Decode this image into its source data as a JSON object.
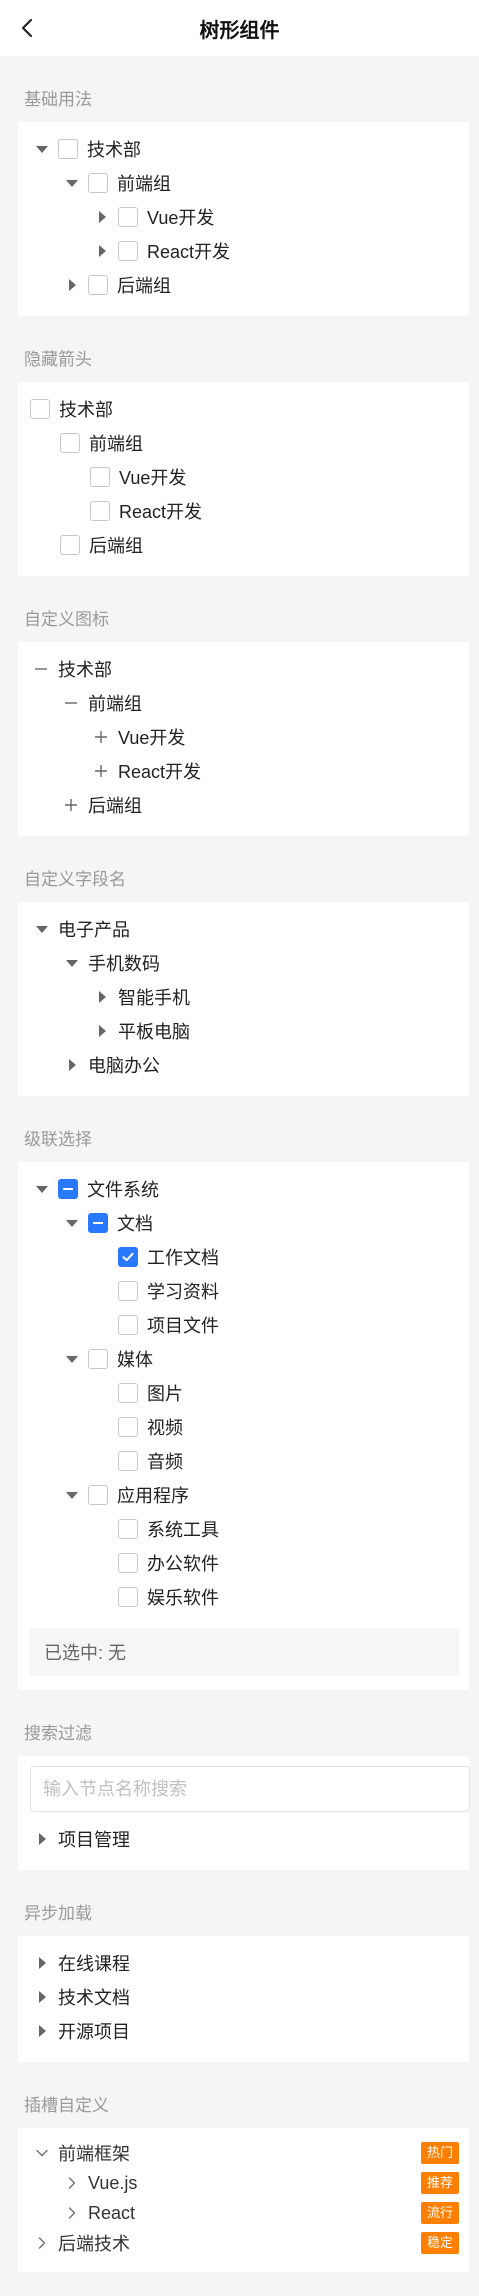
{
  "header": {
    "title": "树形组件"
  },
  "basic": {
    "title": "基础用法",
    "n1": "技术部",
    "n2": "前端组",
    "n3": "Vue开发",
    "n4": "React开发",
    "n5": "后端组"
  },
  "hidden_arrow": {
    "title": "隐藏箭头",
    "n1": "技术部",
    "n2": "前端组",
    "n3": "Vue开发",
    "n4": "React开发",
    "n5": "后端组"
  },
  "custom_icon": {
    "title": "自定义图标",
    "n1": "技术部",
    "n2": "前端组",
    "n3": "Vue开发",
    "n4": "React开发",
    "n5": "后端组"
  },
  "custom_field": {
    "title": "自定义字段名",
    "n1": "电子产品",
    "n2": "手机数码",
    "n3": "智能手机",
    "n4": "平板电脑",
    "n5": "电脑办公"
  },
  "cascade": {
    "title": "级联选择",
    "root": "文件系统",
    "docs": "文档",
    "doc1": "工作文档",
    "doc2": "学习资料",
    "doc3": "项目文件",
    "media": "媒体",
    "media1": "图片",
    "media2": "视频",
    "media3": "音频",
    "apps": "应用程序",
    "app1": "系统工具",
    "app2": "办公软件",
    "app3": "娱乐软件",
    "selected_text": "已选中: 无"
  },
  "search": {
    "title": "搜索过滤",
    "placeholder": "输入节点名称搜索",
    "n1": "项目管理"
  },
  "async": {
    "title": "异步加载",
    "n1": "在线课程",
    "n2": "技术文档",
    "n3": "开源项目"
  },
  "slot": {
    "title": "插槽自定义",
    "n1": "前端框架",
    "b1": "热门",
    "n2": "Vue.js",
    "b2": "推荐",
    "n3": "React",
    "b3": "流行",
    "n4": "后端技术",
    "b4": "稳定"
  },
  "colors": {
    "accent": "#2979ff",
    "badge": "#ff7f00"
  }
}
